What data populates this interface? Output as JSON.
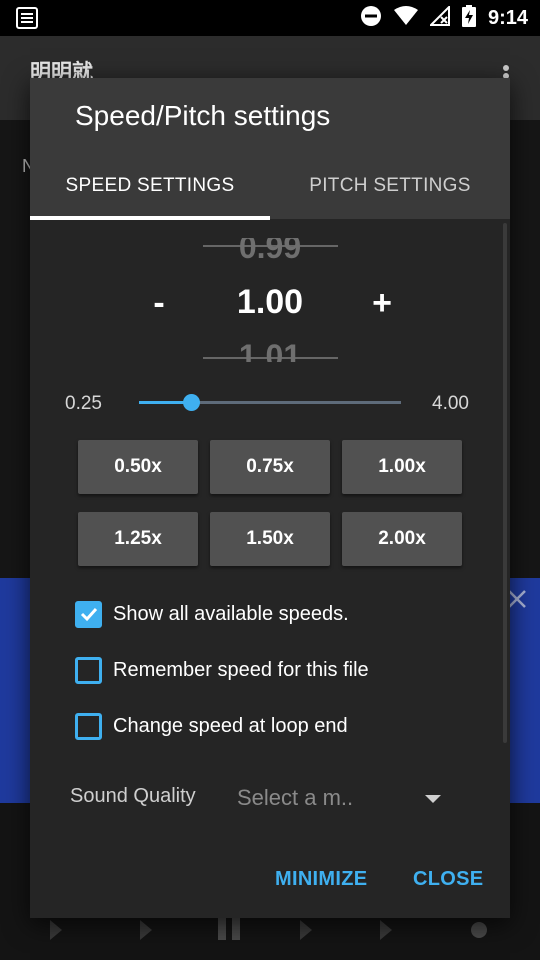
{
  "status_bar": {
    "time": "9:14",
    "icons": [
      "notification-settings-icon",
      "do-not-disturb-icon",
      "wifi-icon",
      "no-sim-icon",
      "battery-charging-icon"
    ]
  },
  "app": {
    "title": "明明就",
    "partial_letter": "N"
  },
  "dialog": {
    "title": "Speed/Pitch settings",
    "tabs": [
      {
        "label": "SPEED SETTINGS",
        "active": true
      },
      {
        "label": "PITCH SETTINGS",
        "active": false
      }
    ],
    "picker": {
      "previous": "0.99",
      "current": "1.00",
      "next": "1.01",
      "decrement_label": "-",
      "increment_label": "+"
    },
    "slider": {
      "min_label": "0.25",
      "max_label": "4.00",
      "min": 0.25,
      "max": 4.0,
      "value": 1.0
    },
    "presets": [
      "0.50x",
      "0.75x",
      "1.00x",
      "1.25x",
      "1.50x",
      "2.00x"
    ],
    "checkboxes": [
      {
        "label": "Show all available speeds.",
        "checked": true
      },
      {
        "label": "Remember speed for this file",
        "checked": false
      },
      {
        "label": "Change speed at loop end",
        "checked": false
      }
    ],
    "sound_quality": {
      "label": "Sound Quality",
      "placeholder": "Select a m.."
    },
    "actions": {
      "minimize": "MINIMIZE",
      "close": "CLOSE"
    }
  },
  "colors": {
    "accent": "#3fb0f0",
    "dialog_bg": "#252525",
    "header_bg": "#3a3a3a",
    "button_bg": "#515151",
    "banner_bg": "#1f3a9e"
  }
}
